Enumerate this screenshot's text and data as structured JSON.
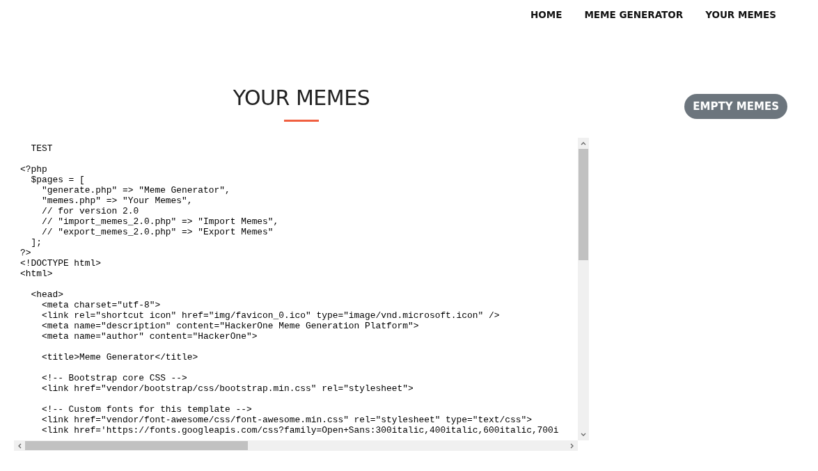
{
  "nav": {
    "items": [
      "HOME",
      "MEME GENERATOR",
      "YOUR MEMES"
    ]
  },
  "page": {
    "title": "YOUR MEMES",
    "empty_button": "EMPTY MEMES"
  },
  "code_view": {
    "blocks": [
      [
        "  TEST"
      ],
      [
        "<?php",
        "  $pages = [",
        "    \"generate.php\" => \"Meme Generator\",",
        "    \"memes.php\" => \"Your Memes\",",
        "    // for version 2.0",
        "    // \"import_memes_2.0.php\" => \"Import Memes\",",
        "    // \"export_memes_2.0.php\" => \"Export Memes\"",
        "  ];",
        "?>",
        "<!DOCTYPE html>",
        "<html>"
      ],
      [
        "  <head>",
        "    <meta charset=\"utf-8\">",
        "    <link rel=\"shortcut icon\" href=\"img/favicon_0.ico\" type=\"image/vnd.microsoft.icon\" />",
        "    <meta name=\"description\" content=\"HackerOne Meme Generation Platform\">",
        "    <meta name=\"author\" content=\"HackerOne\">"
      ],
      [
        "    <title>Meme Generator</title>"
      ],
      [
        "    <!-- Bootstrap core CSS -->",
        "    <link href=\"vendor/bootstrap/css/bootstrap.min.css\" rel=\"stylesheet\">"
      ],
      [
        "    <!-- Custom fonts for this template -->",
        "    <link href=\"vendor/font-awesome/css/font-awesome.min.css\" rel=\"stylesheet\" type=\"text/css\">",
        "    <link href='https://fonts.googleapis.com/css?family=Open+Sans:300italic,400italic,600italic,700i"
      ]
    ]
  }
}
